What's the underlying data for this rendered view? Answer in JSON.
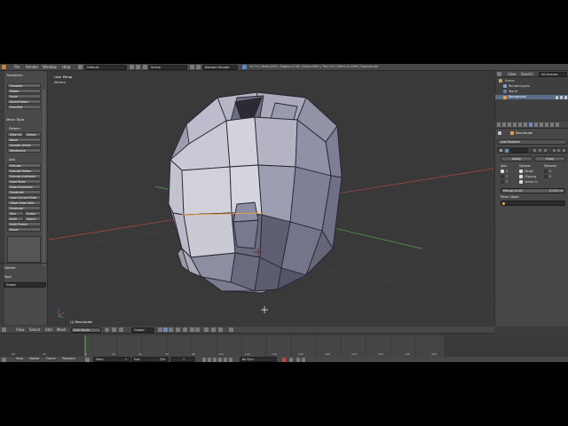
{
  "topbar": {
    "menus": [
      "File",
      "Render",
      "Window",
      "Help"
    ],
    "layout": "Default",
    "scene": "Scene",
    "engine": "Blender Render",
    "stats": "v2.74 | Verts:0/52 | Edges:1/116 | Faces:0/64 | Tris:124 | Mem:12.87M | Roundcube"
  },
  "toolshelf": {
    "transform_header": "Transform",
    "transform_buttons": [
      "Translate",
      "Rotate",
      "Scale",
      "Shrink/Fatten",
      "Push/Pull"
    ],
    "mesh_tools_header": "Mesh Tools",
    "deform_label": "Deform:",
    "deform_row": [
      "Slide Ed",
      "Vertex"
    ],
    "deform_buttons": [
      "Noise",
      "Smooth Vertex",
      "Randomize"
    ],
    "add_label": "Add:",
    "add_buttons": [
      "Extrude",
      "Extrude Region",
      "Extrude Individual",
      "Inset Faces",
      "Make Edge/Face",
      "Subdivide",
      "Loop Cut and Slide",
      "Offset Edge Slide",
      "Duplicate"
    ],
    "spin_row": [
      "Spin",
      "Screw"
    ],
    "knife_row": [
      "Knife",
      "Select"
    ],
    "more_buttons": [
      "Knife Project",
      "Bisect"
    ],
    "delete_header": "Delete",
    "type_label": "Type",
    "type_value": "Edges"
  },
  "viewport": {
    "view_name": "User Persp",
    "units": "Meters",
    "object_label": "(1) Roundcube"
  },
  "viewport_header": {
    "menus": [
      "View",
      "Select",
      "Add",
      "Mesh"
    ],
    "mode": "Edit Mode",
    "pivot": "Global"
  },
  "outliner": {
    "header_buttons": [
      "View",
      "Search",
      "All Scenes"
    ],
    "items": [
      "Scene",
      "RenderLayers",
      "World",
      "Roundcube"
    ]
  },
  "properties": {
    "object_name": "Roundcube",
    "add_modifier": "Add Modifier",
    "apply": "Apply",
    "copy": "Copy",
    "col_axis": "Axis:",
    "col_options": "Options:",
    "col_textures": "Textures:",
    "axes": [
      "X",
      "Y",
      "Z"
    ],
    "options": [
      "Merge",
      "Clipping",
      "Vertex Gr"
    ],
    "textures": [
      "U",
      "V"
    ],
    "merge_limit_label": "Merge Limit:",
    "merge_limit_value": "0.001 m",
    "mirror_object": "Mirror Object"
  },
  "timeline": {
    "menus": [
      "View",
      "Marker",
      "Frame",
      "Playback"
    ],
    "start": "Start:",
    "start_value": "1",
    "end": "End:",
    "end_value": "250",
    "frame": "1",
    "sync": "No Sync",
    "ticks": [
      "-40",
      "-20",
      "0",
      "20",
      "40",
      "60",
      "80",
      "100",
      "120",
      "140",
      "160",
      "180",
      "200",
      "220",
      "240",
      "260"
    ]
  },
  "colors": {
    "selection_orange": "#e8a040",
    "x_axis_red": "#b04848",
    "y_axis_green": "#58a050"
  }
}
